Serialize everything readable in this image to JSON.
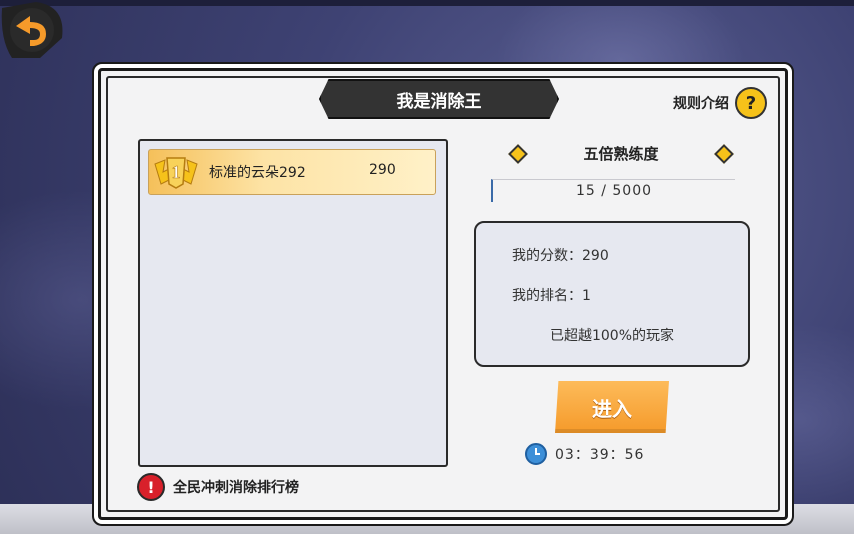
{
  "title": "我是消除王",
  "rules_label": "规则介绍",
  "help_icon": "?",
  "ranking": {
    "items": [
      {
        "rank": "1",
        "name": "标准的云朵292",
        "score": "290"
      }
    ]
  },
  "footer_note": "全民冲刺消除排行榜",
  "alert_icon": "!",
  "experience": {
    "title": "五倍熟练度",
    "progress": "15 / 5000",
    "current": 15,
    "max": 5000
  },
  "stats": {
    "score_line": "我的分数：290",
    "rank_line": "我的排名：1",
    "exceed_line": "已超越100%的玩家"
  },
  "enter_button": "进入",
  "timer": "03：39：56",
  "colors": {
    "accent": "#f59a2a",
    "gold": "#f6c21a",
    "alert": "#d8202a"
  }
}
